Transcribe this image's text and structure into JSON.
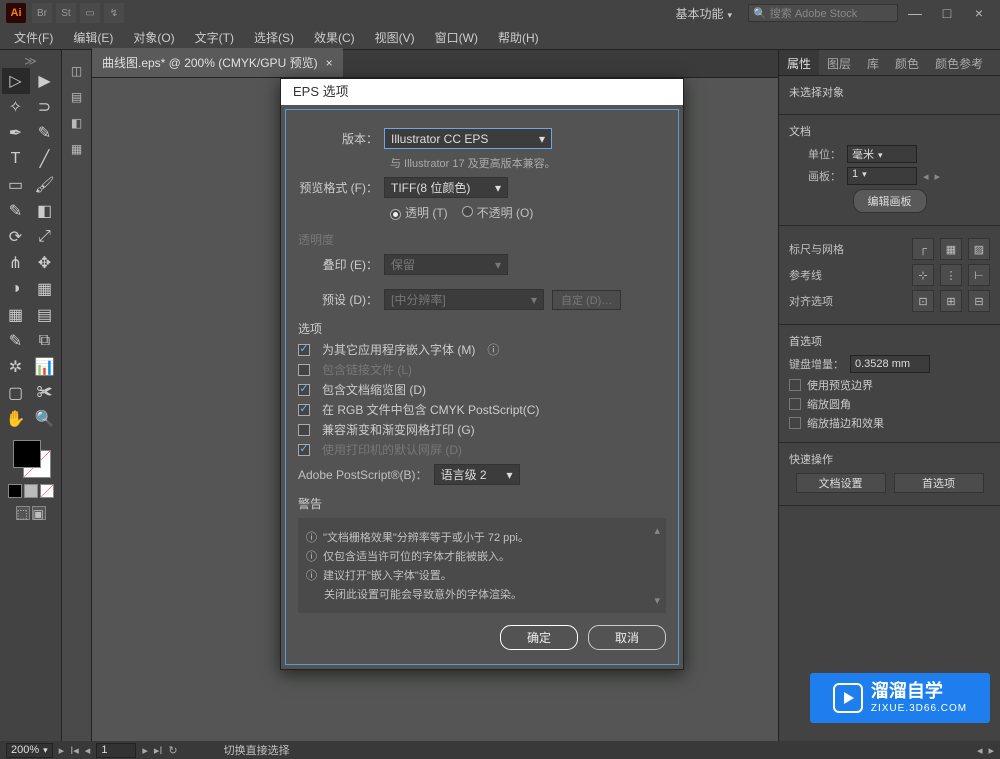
{
  "app": {
    "logo": "Ai",
    "br": "Br",
    "st": "St",
    "workspace": "基本功能",
    "search_ph": "搜索 Adobe Stock"
  },
  "menu": {
    "file": "文件(F)",
    "edit": "编辑(E)",
    "object": "对象(O)",
    "type": "文字(T)",
    "select": "选择(S)",
    "effect": "效果(C)",
    "view": "视图(V)",
    "window": "窗口(W)",
    "help": "帮助(H)"
  },
  "doc": {
    "tab": "曲线图.eps* @ 200% (CMYK/GPU 预览)"
  },
  "rtabs": {
    "p": "属性",
    "l": "图层",
    "lib": "库",
    "col": "颜色",
    "sw": "颜色参考"
  },
  "rpanel": {
    "nosel": "未选择对象",
    "docsec": "文档",
    "unit_lbl": "单位：",
    "unit_val": "毫米",
    "artb_lbl": "画板：",
    "artb_val": "1",
    "editartb": "编辑画板",
    "ruler": "标尺与网格",
    "guides": "参考线",
    "snap": "对齐选项",
    "prefs": "首选项",
    "keyinc_lbl": "键盘增量：",
    "keyinc_val": "0.3528 mm",
    "c1": "使用预览边界",
    "c2": "缩放圆角",
    "c3": "缩放描边和效果",
    "quick": "快速操作",
    "docset": "文档设置",
    "pref": "首选项"
  },
  "status": {
    "zoom": "200%",
    "page": "1",
    "mode": "切换直接选择"
  },
  "watermark": {
    "big": "溜溜自学",
    "small": "ZIXUE.3D66.COM"
  },
  "dlg": {
    "title": "EPS 选项",
    "ver_lbl": "版本：",
    "ver_val": "Illustrator CC EPS",
    "ver_note": "与 Illustrator 17 及更高版本兼容。",
    "prev_lbl": "预览格式 (F)：",
    "prev_val": "TIFF(8 位颜色)",
    "r1": "透明 (T)",
    "r2": "不透明 (O)",
    "trans_sec": "透明度",
    "ovp_lbl": "叠印 (E)：",
    "ovp_val": "保留",
    "preset_lbl": "预设 (D)：",
    "preset_val": "[中分辨率]",
    "custom": "自定 (D)…",
    "opt_sec": "选项",
    "o1": "为其它应用程序嵌入字体 (M)",
    "o2": "包含链接文件 (L)",
    "o3": "包含文档缩览图 (D)",
    "o4": "在 RGB 文件中包含 CMYK PostScript(C)",
    "o5": "兼容渐变和渐变网格打印 (G)",
    "o6": "使用打印机的默认网屏 (D)",
    "ps_lbl": "Adobe PostScript®(B)：",
    "ps_val": "语言级 2",
    "warn": "警告",
    "w1": "\"文档栅格效果\"分辨率等于或小于 72 ppi。",
    "w2": "仅包含适当许可位的字体才能被嵌入。",
    "w3": "建议打开\"嵌入字体\"设置。",
    "w4": "关闭此设置可能会导致意外的字体渲染。",
    "ok": "确定",
    "cancel": "取消"
  }
}
